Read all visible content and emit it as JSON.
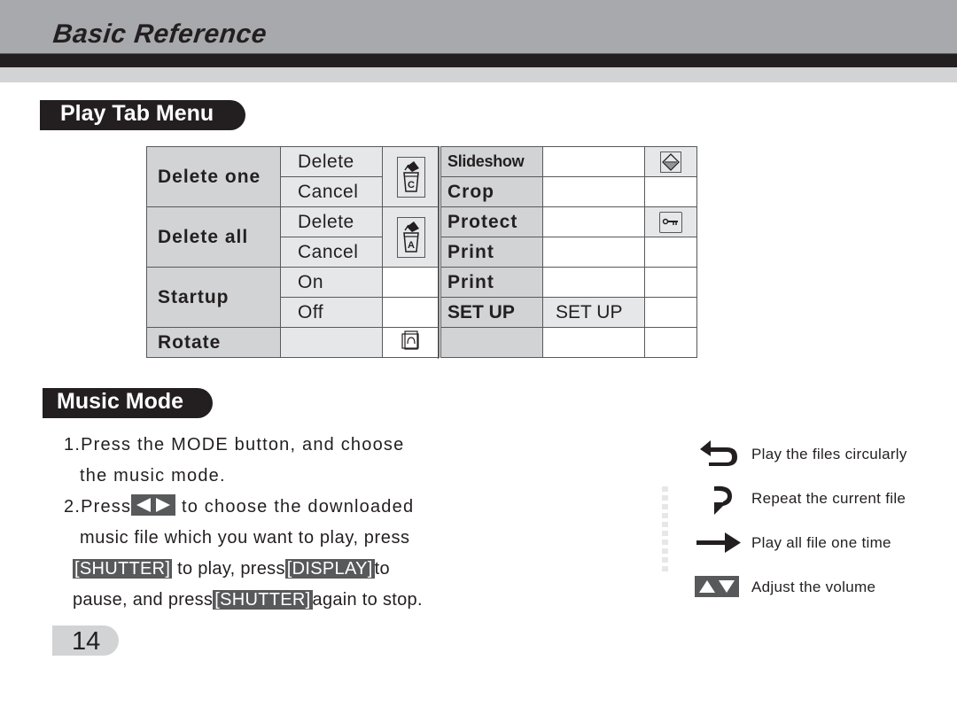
{
  "header": {
    "title": "Basic Reference"
  },
  "play_tab_menu": {
    "section_title": "Play Tab Menu",
    "left_table": [
      {
        "label": "Delete one",
        "options": [
          "Delete",
          "Cancel"
        ],
        "icon": "trash-c-icon"
      },
      {
        "label": "Delete all",
        "options": [
          "Delete",
          "Cancel"
        ],
        "icon": "trash-a-icon"
      },
      {
        "label": "Startup",
        "options": [
          "On",
          "Off"
        ],
        "icon": ""
      },
      {
        "label": "Rotate",
        "options": [
          ""
        ],
        "icon": "rotate-icon"
      }
    ],
    "right_table": [
      {
        "label": "Slideshow",
        "value": "",
        "icon": "slideshow-icon"
      },
      {
        "label": "Crop",
        "value": "",
        "icon": ""
      },
      {
        "label": "Protect",
        "value": "",
        "icon": "key-icon"
      },
      {
        "label": "Print",
        "value": "",
        "icon": ""
      },
      {
        "label": "Print",
        "value": "",
        "icon": ""
      },
      {
        "label": "SET UP",
        "value": "SET UP",
        "icon": ""
      },
      {
        "label": "",
        "value": "",
        "icon": ""
      }
    ]
  },
  "music_mode": {
    "section_title": "Music Mode",
    "step1_line1": "1.Press the MODE button, and choose",
    "step1_line2": "the music mode.",
    "step2_prefix": "2.Press",
    "step2_suffix": " to choose the downloaded",
    "step2_line2": "music file which you want to play, press",
    "key_shutter": "[SHUTTER]",
    "key_display": "[DISPLAY]",
    "step2_line3_mid": " to play, press",
    "step2_line3_end": "to",
    "step2_line4_start": "pause, and press",
    "step2_line4_end": "again to stop.",
    "legend": [
      {
        "icon": "loop-back-icon",
        "label": "Play the files circularly"
      },
      {
        "icon": "repeat-one-icon",
        "label": "Repeat the current file"
      },
      {
        "icon": "arrow-right-icon",
        "label": "Play all file one time"
      },
      {
        "icon": "volume-up-down-icon",
        "label": "Adjust the volume"
      }
    ]
  },
  "page_number": "14"
}
